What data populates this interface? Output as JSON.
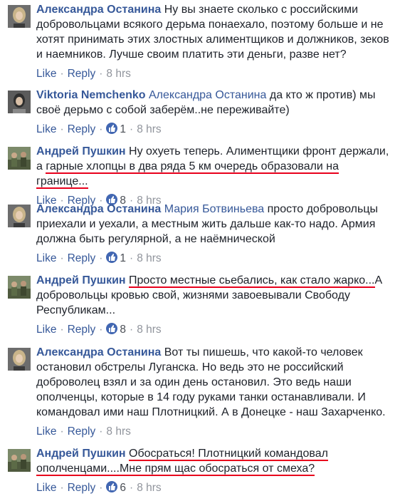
{
  "comments": [
    {
      "author": "Александра Останина",
      "mention": "",
      "text": "Ну вы знаете сколько с российскими добровольцами всякого дерьма понаехало, поэтому больше и не хотят принимать этих злостных алиментщиков и должников, зеков и наемников. Лучше своим платить эти деньги, разве нет?",
      "like": "Like",
      "reply": "Reply",
      "reactions": "",
      "time": "8 hrs",
      "avatar": "blonde-woman-avatar"
    },
    {
      "author": "Viktoria Nemchenko",
      "mention": "Александра Останина",
      "text": "да кто ж против) мы своё дерьмо с собой заберём..не переживайте)",
      "like": "Like",
      "reply": "Reply",
      "reactions": "1",
      "time": "8 hrs",
      "avatar": "woman-avatar"
    },
    {
      "author": "Андрей Пушкин",
      "mention": "",
      "text_plain": "Ну охуеть теперь. Алиментщики фронт держали, а ",
      "text_underlined": "гарные хлопцы в два ряда 5 км очередь образовали на границе...",
      "like": "Like",
      "reply": "Reply",
      "reactions": "8",
      "time": "8 hrs",
      "avatar": "soldiers-avatar"
    },
    {
      "author": "Александра Останина",
      "mention": "Мария Ботвиньева",
      "text": "просто добровольцы приехали и уехали, а местным жить дальше как-то надо. Армия должна быть регулярной, а не наёмнической",
      "like": "Like",
      "reply": "Reply",
      "reactions": "1",
      "time": "8 hrs",
      "avatar": "blonde-woman-avatar"
    },
    {
      "author": "Андрей Пушкин",
      "mention": "",
      "text_underlined": "Просто местные сьебались, как стало жарко...",
      "text_plain": "А добровольцы кровью свой, жизнями завоевывали Свободу Республикам...",
      "like": "Like",
      "reply": "Reply",
      "reactions": "8",
      "time": "8 hrs",
      "avatar": "soldiers-avatar"
    },
    {
      "author": "Александра Останина",
      "mention": "",
      "text": "Вот ты пишешь, что какой-то человек остановил обстрелы Луганска. Но ведь это не российский доброволец взял и за один день остановил. Это ведь наши ополченцы, которые в 14 году руками танки останавливали. И командовал ими наш Плотницкий. А в Донецке - наш Захарченко.",
      "like": "Like",
      "reply": "Reply",
      "reactions": "",
      "time": "8 hrs",
      "avatar": "blonde-woman-avatar"
    },
    {
      "author": "Андрей Пушкин",
      "mention": "",
      "text_underlined": "Обосраться! Плотницкий командовал ополченцами....Мне прям щас обосраться от смеха?",
      "like": "Like",
      "reply": "Reply",
      "reactions": "6",
      "time": "8 hrs",
      "avatar": "soldiers-avatar"
    }
  ],
  "colors": {
    "link": "#365899",
    "meta": "#90949c",
    "underline": "#e8001c",
    "like_badge": "#4267b2"
  }
}
